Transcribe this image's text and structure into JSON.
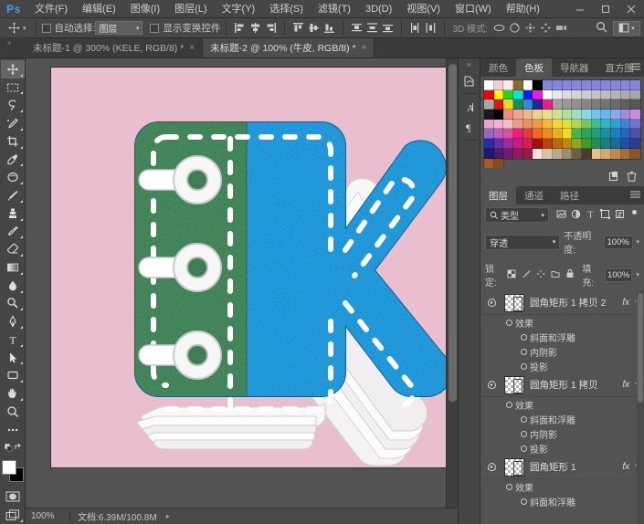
{
  "app": {
    "logo": "Ps",
    "menu": [
      "文件(F)",
      "编辑(E)",
      "图像(I)",
      "图层(L)",
      "文字(Y)",
      "选择(S)",
      "滤镜(T)",
      "3D(D)",
      "视图(V)",
      "窗口(W)",
      "帮助(H)"
    ],
    "window_controls": [
      "minimize-button",
      "maximize-button",
      "close-button"
    ]
  },
  "options_bar": {
    "tool_icon": "move-tool-icon",
    "auto_select_label": "自动选择:",
    "auto_select_value": "图层",
    "show_transform_label": "显示变换控件",
    "mode_3d_label": "3D 模式:",
    "align_icons": [
      "align-left-edges",
      "align-horizontal-centers",
      "align-right-edges",
      "align-top-edges",
      "align-vertical-centers",
      "align-bottom-edges",
      "distribute-top",
      "distribute-vertical-center",
      "distribute-bottom",
      "distribute-left",
      "distribute-horizontal-center",
      "distribute-right"
    ],
    "icons_3d": [
      "rotate-3d",
      "roll-3d",
      "drag-3d",
      "slide-3d",
      "scale-3d"
    ],
    "search_icon": "search-icon",
    "workspace_icon": "workspace-switcher"
  },
  "tabs": [
    {
      "label": "未标题-1 @ 300% (KELE, RGB/8) *",
      "active": false,
      "close": "×"
    },
    {
      "label": "未标题-2 @ 100% (牛皮, RGB/8) *",
      "active": true,
      "close": "×"
    }
  ],
  "toolbar": {
    "tools": [
      "move-tool",
      "rectangular-marquee-tool",
      "lasso-tool",
      "quick-selection-tool",
      "crop-tool",
      "eyedropper-tool",
      "spot-healing-brush-tool",
      "brush-tool",
      "clone-stamp-tool",
      "history-brush-tool",
      "eraser-tool",
      "gradient-tool",
      "blur-tool",
      "dodge-tool",
      "pen-tool",
      "horizontal-type-tool",
      "path-selection-tool",
      "rectangle-tool",
      "hand-tool",
      "zoom-tool",
      "edit-toolbar-tool"
    ],
    "foreground_color": "#ffffff",
    "background_color": "#000000",
    "quick_mask": "quick-mask-mode",
    "screen_mode": "screen-mode"
  },
  "canvas": {
    "background_color": "#e9bfd0",
    "artwork": {
      "letter": "K",
      "spine_color": "#3d7a4e",
      "body_color": "#2193cf",
      "stitch_color": "#ffffff",
      "ring_color": "#f2f2f2",
      "page_edge_color": "#fdfdfd"
    }
  },
  "status_bar": {
    "zoom": "100%",
    "doc_label": "文档:6.39M/100.8M",
    "arrow": "▸"
  },
  "dock_icons": [
    "history-panel-icon",
    "character-panel-icon",
    "paragraph-panel-icon"
  ],
  "color_panel": {
    "tabs": [
      {
        "label": "颜色",
        "active": false
      },
      {
        "label": "色板",
        "active": true
      },
      {
        "label": "导航器",
        "active": false
      },
      {
        "label": "直方图",
        "active": false
      }
    ],
    "menu_icon": "panel-menu-icon",
    "swatches": [
      "#ffffff",
      "#f2cdd8",
      "#fbe9ef",
      "#8a6a33",
      "#ffffff",
      "#000000",
      "#8686d8",
      "#8686d8",
      "#8686d8",
      "#8686d8",
      "#8686d8",
      "#8686d8",
      "#8686d8",
      "#8686d8",
      "#8686d8",
      "#8686d8",
      "#f10000",
      "#ffff00",
      "#27d51d",
      "#14e0d5",
      "#1b1bf0",
      "#f815e8",
      "#fcfcfc",
      "#e8e8e8",
      "#dedede",
      "#d4d4d4",
      "#cccccc",
      "#c4c4c4",
      "#bcbcbc",
      "#b4b4b4",
      "#ababab",
      "#a6a6a6",
      "#a8a8a8",
      "#e01414",
      "#f2d91b",
      "#1f8a52",
      "#2b8fd6",
      "#1b2a8a",
      "#ee1b8a",
      "#a0a0a0",
      "#999999",
      "#909090",
      "#868686",
      "#7d7d7d",
      "#737373",
      "#6a6a6a",
      "#5f5f5f",
      "#575757",
      "#1a1a1a",
      "#000000",
      "#ea8d7f",
      "#f0a38c",
      "#f0b78c",
      "#f0cf8c",
      "#eae08c",
      "#cfe096",
      "#aee0a2",
      "#9ee0c0",
      "#8cd8e0",
      "#6ec8ea",
      "#6eb4ea",
      "#8ea8e8",
      "#a08edb",
      "#c78edb",
      "#e8a4cf",
      "#efb1d1",
      "#f2c0c2",
      "#ef9a86",
      "#f08f5e",
      "#f09a3e",
      "#f5b63a",
      "#f7d63a",
      "#e2e03a",
      "#b2d84a",
      "#6ec85e",
      "#3cbf8e",
      "#31b6c4",
      "#27a3dc",
      "#3b84d8",
      "#6f74cf",
      "#9a63c4",
      "#c05bb8",
      "#d8509c",
      "#f0197a",
      "#e03a3a",
      "#f06a1e",
      "#f08a1e",
      "#f0ad1e",
      "#f5d81e",
      "#3fb554",
      "#2fa05e",
      "#2a9a7e",
      "#1f8fa0",
      "#1d7fc0",
      "#2a64b8",
      "#4a52a8",
      "#2b2ba0",
      "#6b2ba8",
      "#9c2b9c",
      "#c41e7a",
      "#d81e4e",
      "#a00f0f",
      "#b8440f",
      "#b86a0f",
      "#b88a0f",
      "#8aa81e",
      "#3f9a2a",
      "#2a8a5e",
      "#1f7a7a",
      "#1a6aa0",
      "#1e4fa0",
      "#2b3f8a",
      "#1b1b6e",
      "#4a1b7a",
      "#6e1b74",
      "#8e1b5e",
      "#9a1b3e",
      "#f3e6d6",
      "#d6c3aa",
      "#b8a88e",
      "#9c8c74",
      "#6e5c44",
      "#4a3c28",
      "#e8c08a",
      "#d6a868",
      "#c08a4a",
      "#a86e34",
      "#8a5424",
      "#a85a24",
      "#8a4a1e",
      "",
      "",
      "",
      "",
      "",
      "",
      "",
      "",
      "",
      "",
      "",
      "",
      "",
      ""
    ],
    "footer_icons": [
      "new-swatch-icon",
      "delete-swatch-icon"
    ]
  },
  "layers_panel": {
    "tabs": [
      {
        "label": "图层",
        "active": true
      },
      {
        "label": "通道",
        "active": false
      },
      {
        "label": "路径",
        "active": false
      }
    ],
    "menu_icon": "panel-menu-icon",
    "filter_label": "类型",
    "filter_icons": [
      "filter-pixel-icon",
      "filter-adjustment-icon",
      "filter-type-icon",
      "filter-shape-icon",
      "filter-smart-object-icon",
      "filter-toggle-icon"
    ],
    "blend_mode": "穿透",
    "opacity_label": "不透明度:",
    "opacity_value": "100%",
    "lock_label": "锁定:",
    "lock_icons": [
      "lock-transparent-pixels",
      "lock-image-pixels",
      "lock-position",
      "lock-artboard-nesting",
      "lock-all"
    ],
    "fill_label": "填充:",
    "fill_value": "100%",
    "layers": [
      {
        "name": "圆角矩形 1 拷贝 2",
        "visible": true,
        "fx_badge": "fx",
        "effects_label": "效果",
        "effects": [
          "斜面和浮雕",
          "内阴影",
          "投影"
        ]
      },
      {
        "name": "圆角矩形 1 拷贝",
        "visible": true,
        "fx_badge": "fx",
        "effects_label": "效果",
        "effects": [
          "斜面和浮雕",
          "内阴影",
          "投影"
        ]
      },
      {
        "name": "圆角矩形 1",
        "visible": true,
        "fx_badge": "fx",
        "effects_label": "效果",
        "effects": [
          "斜面和浮雕"
        ]
      }
    ]
  }
}
